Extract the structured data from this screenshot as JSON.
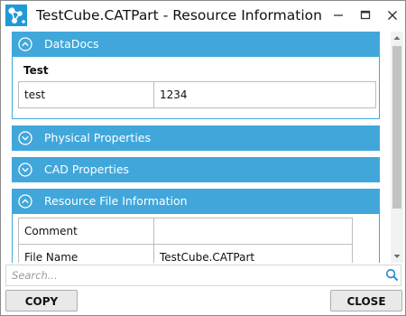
{
  "window": {
    "title": "TestCube.CATPart - Resource Information",
    "minimize_label": "–",
    "maximize_label": "☐",
    "close_label": "✕"
  },
  "sections": {
    "datadocs": {
      "title": "DataDocs",
      "expanded": true,
      "group_title": "Test",
      "rows": [
        {
          "name": "test",
          "value": "1234"
        }
      ]
    },
    "physical": {
      "title": "Physical Properties",
      "expanded": false
    },
    "cad": {
      "title": "CAD Properties",
      "expanded": false
    },
    "resource_file": {
      "title": "Resource File Information",
      "expanded": true,
      "rows": [
        {
          "name": "Comment",
          "value": ""
        },
        {
          "name": "File Name",
          "value": "TestCube.CATPart"
        }
      ]
    }
  },
  "search": {
    "placeholder": "Search...",
    "value": ""
  },
  "buttons": {
    "copy": "COPY",
    "close": "CLOSE"
  },
  "colors": {
    "accent": "#41a7da",
    "border": "#bdbdbd",
    "thumb": "#c3c3c3"
  },
  "icons": {
    "app": "network-nodes-icon",
    "section_expanded": "chevron-up-circle-icon",
    "section_collapsed": "chevron-down-circle-icon",
    "search": "magnifier-icon"
  }
}
